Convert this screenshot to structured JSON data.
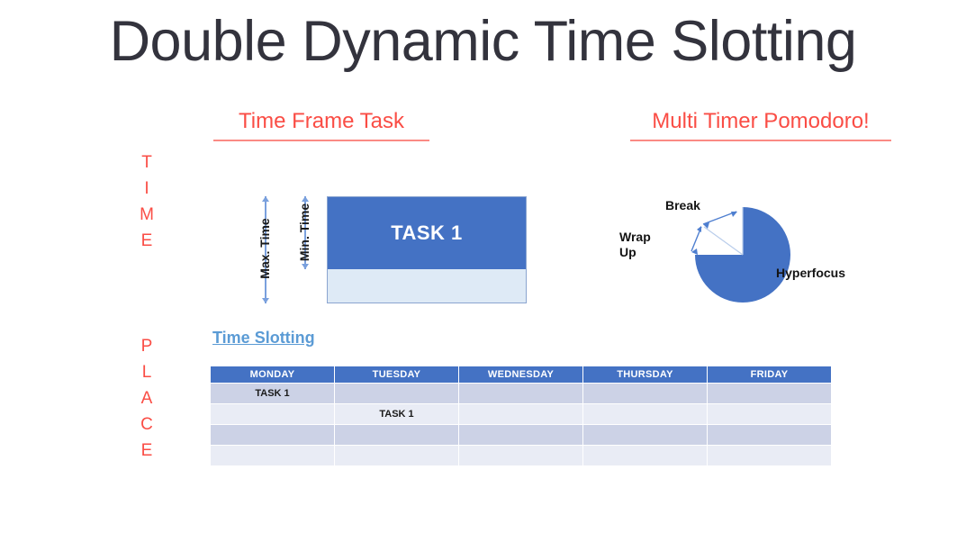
{
  "slide": {
    "title": "Double Dynamic Time Slotting",
    "background_color": "#ffffff",
    "title_color": "#33333d",
    "accent_red": "#fa4d45",
    "accent_blue": "#4472c4"
  },
  "axis_words": {
    "time": [
      "T",
      "I",
      "M",
      "E"
    ],
    "place": [
      "P",
      "L",
      "A",
      "C",
      "E"
    ]
  },
  "sections": {
    "time_frame_task": {
      "heading": "Time Frame Task",
      "task_label": "TASK 1",
      "max_time_label": "Max. Time",
      "min_time_label": "Min. Time",
      "blue_color": "#4472c4",
      "light_color": "#deeaf6",
      "arrow_color": "#7aa0dd"
    },
    "multi_timer_pomodoro": {
      "heading": "Multi Timer Pomodoro!",
      "labels": {
        "break": "Break",
        "wrap_up_line1": "Wrap",
        "wrap_up_line2": "Up",
        "hyperfocus": "Hyperfocus"
      }
    },
    "time_slotting": {
      "heading": "Time Slotting",
      "columns": [
        "MONDAY",
        "TUESDAY",
        "WEDNESDAY",
        "THURSDAY",
        "FRIDAY"
      ],
      "rows": [
        {
          "shade": "dark",
          "cells": [
            "TASK 1",
            "",
            "",
            "",
            ""
          ]
        },
        {
          "shade": "light",
          "cells": [
            "",
            "TASK 1",
            "",
            "",
            ""
          ]
        },
        {
          "shade": "dark",
          "cells": [
            "",
            "",
            "",
            "",
            ""
          ]
        },
        {
          "shade": "light",
          "cells": [
            "",
            "",
            "",
            "",
            ""
          ]
        }
      ],
      "header_bg": "#4472c4",
      "row_dark_bg": "#ccd2e6",
      "row_light_bg": "#e9ecf5"
    }
  },
  "chart_data": {
    "type": "pie",
    "title": "Multi Timer Pomodoro!",
    "categories": [
      "Hyperfocus",
      "Break",
      "Wrap Up"
    ],
    "values": [
      75,
      15,
      10
    ],
    "colors": [
      "#4472c4",
      "#ffffff",
      "#ffffff"
    ],
    "start_angle_deg": 0,
    "direction": "clockwise",
    "legend": "none",
    "annotations": [
      "Hyperfocus slice is filled blue and spans three quarters of the circle",
      "Break and Wrap Up slices are unfilled (white) with thin divider lines and double-headed arc arrows"
    ]
  }
}
